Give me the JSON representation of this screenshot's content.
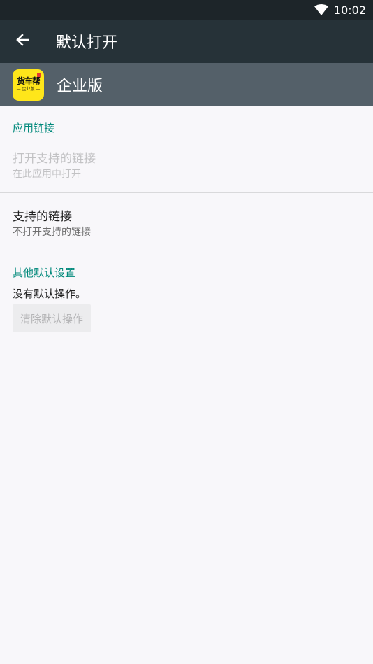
{
  "status_bar": {
    "time": "10:02",
    "wifi_icon": "wifi-icon"
  },
  "toolbar": {
    "title": "默认打开",
    "back_icon": "arrow-back-icon"
  },
  "app": {
    "name": "企业版",
    "icon_main": "货车帮",
    "icon_sub": "— 企业版 —",
    "icon_color": "#ffe61a"
  },
  "app_links": {
    "section_label": "应用链接",
    "open_supported": {
      "title": "打开支持的链接",
      "subtitle": "在此应用中打开"
    },
    "supported_links": {
      "title": "支持的链接",
      "subtitle": "不打开支持的链接"
    }
  },
  "other_defaults": {
    "section_label": "其他默认设置",
    "message": "没有默认操作。",
    "clear_button": "清除默认操作"
  },
  "colors": {
    "status_bar": "#1d2529",
    "toolbar": "#263238",
    "app_header": "#546069",
    "accent": "#00897b",
    "background": "#f8f7fa"
  }
}
